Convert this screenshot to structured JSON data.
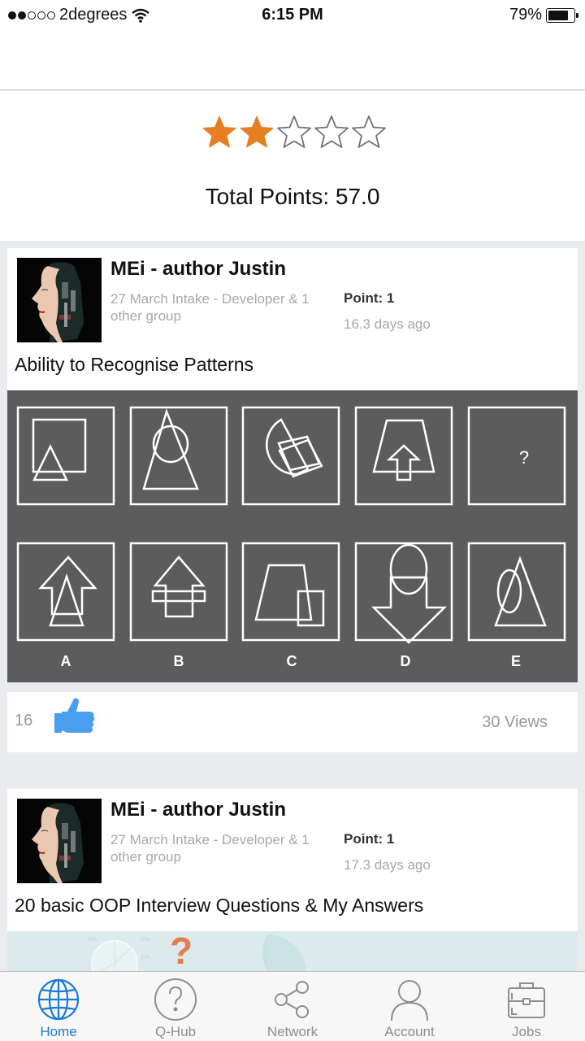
{
  "status_bar": {
    "carrier": "2degrees",
    "signal_bars_filled": 2,
    "signal_bars_total": 5,
    "time": "6:15 PM",
    "battery_percent_text": "79%",
    "battery_level": 0.79
  },
  "summary": {
    "rating": 2,
    "rating_max": 5,
    "star_filled_color": "#e67e22",
    "star_empty_color": "#6e7180",
    "total_points_label": "Total Points: 57.0"
  },
  "posts": [
    {
      "author": "MEi - author Justin",
      "group": "27 March Intake - Developer & 1 other group",
      "point": "Point: 1",
      "ago": "16.3 days ago",
      "title": "Ability to Recognise Patterns",
      "puzzle": {
        "labels": [
          "A",
          "B",
          "C",
          "D",
          "E"
        ],
        "question_mark": "?"
      },
      "likes": "16",
      "views": "30 Views"
    },
    {
      "author": "MEi - author Justin",
      "group": "27 March Intake - Developer & 1 other group",
      "point": "Point: 1",
      "ago": "17.3 days ago",
      "title": "20 basic OOP Interview Questions & My Answers"
    }
  ],
  "tab_bar": {
    "active_color": "#1a7ad9",
    "tabs": [
      {
        "label": "Home",
        "icon": "globe-icon",
        "active": true
      },
      {
        "label": "Q-Hub",
        "icon": "question-circle-icon",
        "active": false
      },
      {
        "label": "Network",
        "icon": "share-icon",
        "active": false
      },
      {
        "label": "Account",
        "icon": "person-icon",
        "active": false
      },
      {
        "label": "Jobs",
        "icon": "briefcase-icon",
        "active": false
      }
    ]
  }
}
